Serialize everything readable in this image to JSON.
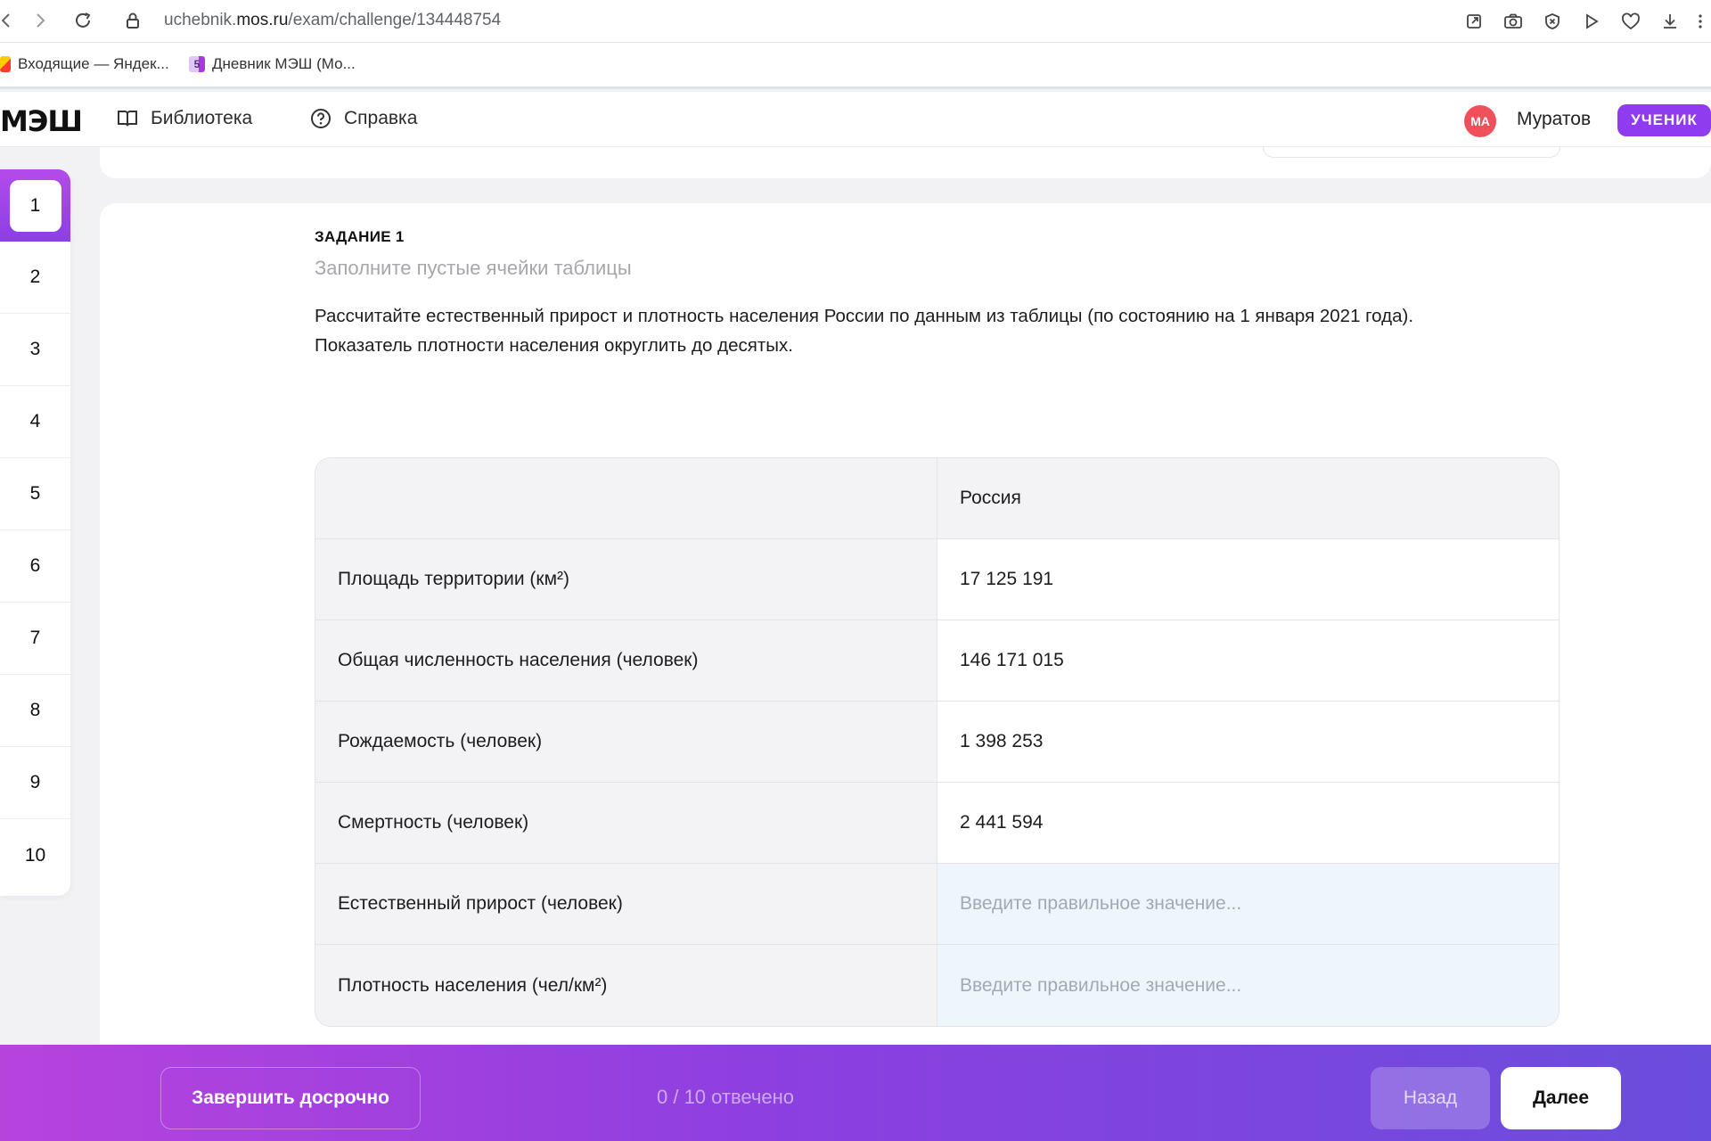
{
  "browser": {
    "url_domain_prefix": "uchebnik.",
    "url_domain": "mos.ru",
    "url_path": "/exam/challenge/134448754",
    "icons": [
      "back-icon",
      "forward-icon",
      "reload-icon",
      "lock-icon",
      "share-icon",
      "camera-icon",
      "block-icon",
      "play-icon",
      "heart-icon",
      "download-icon",
      "more-icon"
    ]
  },
  "bookmarks": [
    {
      "label": "Входящие — Яндек..."
    },
    {
      "label": "Дневник МЭШ (Мо...",
      "badge": "5"
    }
  ],
  "header": {
    "logo": "МЭШ",
    "nav": [
      {
        "label": "Библиотека",
        "icon": "book-icon"
      },
      {
        "label": "Справка",
        "icon": "help-icon"
      }
    ],
    "avatar_initials": "МА",
    "user_name": "Муратов",
    "role": "УЧЕНИК"
  },
  "sidebar": {
    "items": [
      "1",
      "2",
      "3",
      "4",
      "5",
      "6",
      "7",
      "8",
      "9",
      "10"
    ],
    "active": "1"
  },
  "task": {
    "label": "ЗАДАНИЕ 1",
    "hint": "Заполните пустые ячейки таблицы",
    "text_line1": "Рассчитайте естественный прирост и плотность населения России по данным из таблицы (по состоянию на 1 января 2021 года).",
    "text_line2": "Показатель плотности населения округлить до десятых."
  },
  "table": {
    "header": {
      "label": "",
      "value": "Россия"
    },
    "rows": [
      {
        "label": "Площадь территории (км²)",
        "value": "17 125 191"
      },
      {
        "label": "Общая численность населения (человек)",
        "value": "146 171 015"
      },
      {
        "label": "Рождаемость (человек)",
        "value": "1 398 253"
      },
      {
        "label": "Смертность (человек)",
        "value": "2 441 594"
      },
      {
        "label": "Естественный прирост (человек)",
        "placeholder": "Введите правильное значение..."
      },
      {
        "label": "Плотность населения (чел/км²)",
        "placeholder": "Введите правильное значение..."
      }
    ]
  },
  "footer": {
    "finish_label": "Завершить досрочно",
    "progress": "0 / 10 отвечено",
    "back_label": "Назад",
    "next_label": "Далее"
  },
  "colors": {
    "accent": "#8f3cf0",
    "avatar": "#f0505a",
    "bar_start": "#b743dd",
    "bar_end": "#6a4ddc",
    "input_bg": "#eef6fc"
  }
}
